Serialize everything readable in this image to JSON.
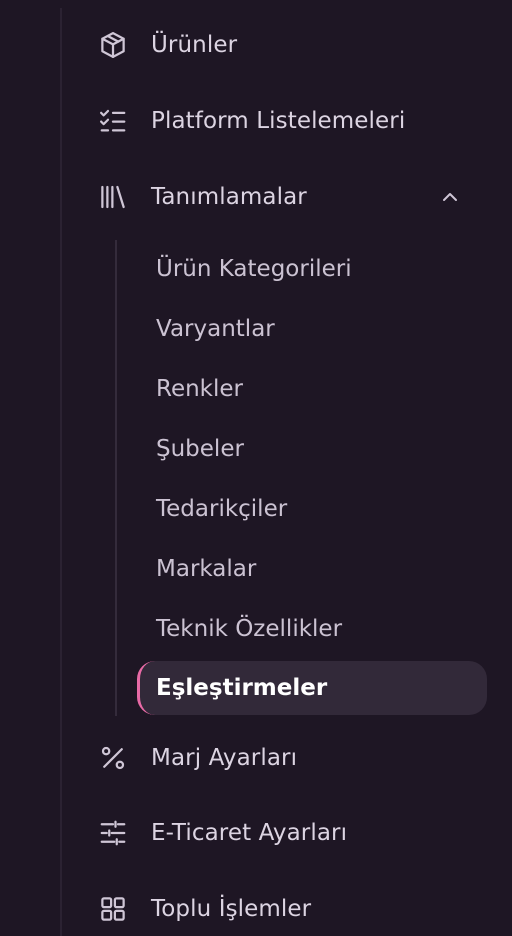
{
  "sidebar": {
    "top_items": [
      {
        "label": "Ürünler",
        "icon": "box-icon"
      },
      {
        "label": "Platform Listelemeleri",
        "icon": "checklist-icon"
      },
      {
        "label": "Tanımlamalar",
        "icon": "library-icon",
        "expanded": true
      }
    ],
    "submenu": [
      {
        "label": "Ürün Kategorileri"
      },
      {
        "label": "Varyantlar"
      },
      {
        "label": "Renkler"
      },
      {
        "label": "Şubeler"
      },
      {
        "label": "Tedarikçiler"
      },
      {
        "label": "Markalar"
      },
      {
        "label": "Teknik Özellikler"
      },
      {
        "label": "Eşleştirmeler",
        "active": true
      }
    ],
    "bottom_items": [
      {
        "label": "Marj Ayarları",
        "icon": "percent-icon"
      },
      {
        "label": "E-Ticaret Ayarları",
        "icon": "sliders-icon"
      },
      {
        "label": "Toplu İşlemler",
        "icon": "grid-icon"
      }
    ]
  },
  "colors": {
    "background": "#1e1624",
    "text": "#dcd4e2",
    "active_bg": "#322939",
    "active_accent": "#e86aa6"
  }
}
